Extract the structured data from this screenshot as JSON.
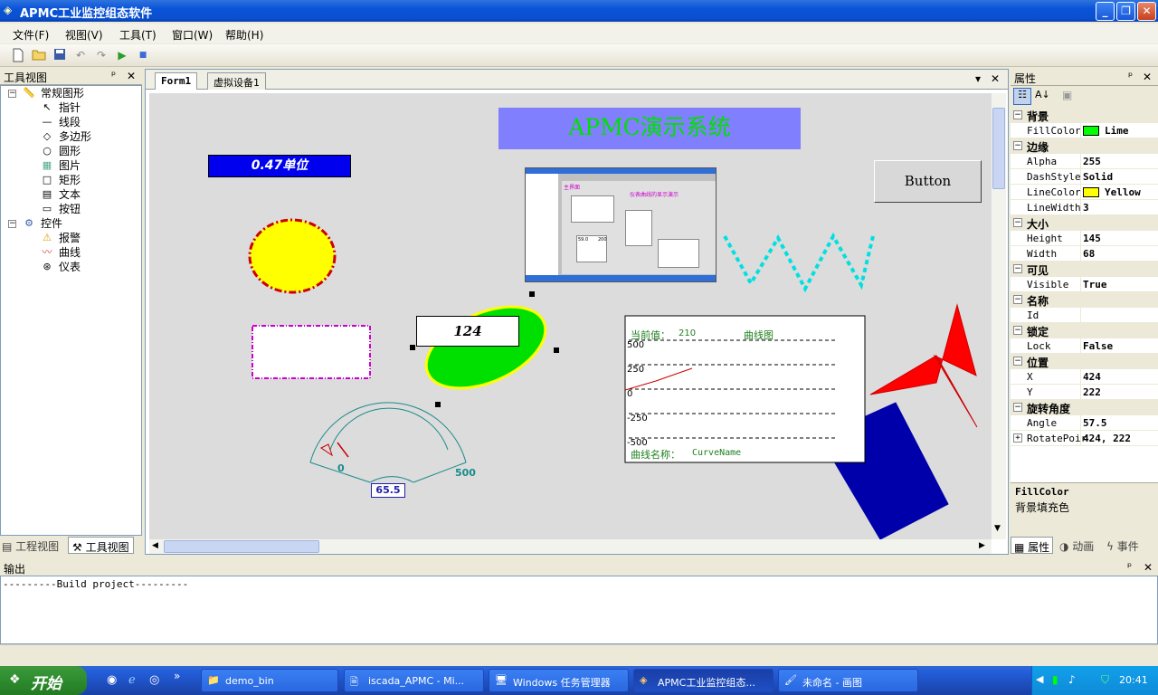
{
  "app": {
    "title": "APMC工业监控组态软件",
    "min": "_",
    "max": "❐",
    "close": "✕"
  },
  "menu": [
    "文件(F)",
    "视图(V)",
    "工具(T)",
    "窗口(W)",
    "帮助(H)"
  ],
  "left_panel": {
    "title": "工具视图",
    "pin": "ᵖ",
    "close": "✕",
    "tree": {
      "group1": "常规图形",
      "items1": [
        "指针",
        "线段",
        "多边形",
        "圆形",
        "图片",
        "矩形",
        "文本",
        "按钮"
      ],
      "group2": "控件",
      "items2": [
        "报警",
        "曲线",
        "仪表"
      ]
    },
    "tabs": [
      "工程视图",
      "工具视图"
    ]
  },
  "doc": {
    "tabs": [
      "Form1",
      "虚拟设备1"
    ],
    "dropdown": "▾",
    "close": "✕"
  },
  "canvas": {
    "banner": "APMC演示系统",
    "value_box": "0.47单位",
    "button": "Button",
    "text_124": "124",
    "gauge": {
      "min": "0",
      "max": "500",
      "value": "65.5"
    },
    "curve": {
      "current_label": "当前值：",
      "current_value": "210",
      "title": "曲线图",
      "y_ticks": [
        "500",
        "250",
        "0",
        "-250",
        "-500"
      ],
      "name_label": "曲线名称：",
      "name_value": "CurveName"
    },
    "thumb": {
      "t1": "主界面",
      "t2": "仪表曲线的显示演示",
      "t3": "59.0",
      "t4": "200"
    }
  },
  "props": {
    "title": "属性",
    "pin": "ᵖ",
    "close": "✕",
    "categories": [
      {
        "name": "背景",
        "rows": [
          {
            "n": "FillColor",
            "v": "Lime",
            "color": "#00ff00"
          }
        ]
      },
      {
        "name": "边缘",
        "rows": [
          {
            "n": "Alpha",
            "v": "255"
          },
          {
            "n": "DashStyle",
            "v": "Solid"
          },
          {
            "n": "LineColor",
            "v": "Yellow",
            "color": "#ffff00"
          },
          {
            "n": "LineWidth",
            "v": "3"
          }
        ]
      },
      {
        "name": "大小",
        "rows": [
          {
            "n": "Height",
            "v": "145"
          },
          {
            "n": "Width",
            "v": "68"
          }
        ]
      },
      {
        "name": "可见",
        "rows": [
          {
            "n": "Visible",
            "v": "True"
          }
        ]
      },
      {
        "name": "名称",
        "rows": [
          {
            "n": "Id",
            "v": ""
          }
        ]
      },
      {
        "name": "锁定",
        "rows": [
          {
            "n": "Lock",
            "v": "False"
          }
        ]
      },
      {
        "name": "位置",
        "rows": [
          {
            "n": "X",
            "v": "424"
          },
          {
            "n": "Y",
            "v": "222"
          }
        ]
      },
      {
        "name": "旋转角度",
        "rows": [
          {
            "n": "Angle",
            "v": "57.5"
          },
          {
            "n": "RotatePoir",
            "v": "424, 222",
            "expand": "+"
          }
        ]
      }
    ],
    "desc_title": "FillColor",
    "desc_text": "背景填充色",
    "tabs": [
      "属性",
      "动画",
      "事件"
    ]
  },
  "output": {
    "title": "输出",
    "pin": "ᵖ",
    "close": "✕",
    "text": "---------Build project---------"
  },
  "taskbar": {
    "start": "开始",
    "tasks": [
      "demo_bin",
      "iscada_APMC - Mi...",
      "Windows 任务管理器",
      "APMC工业监控组态...",
      "未命名 - 画图"
    ],
    "time": "20:41",
    "more": "»"
  }
}
